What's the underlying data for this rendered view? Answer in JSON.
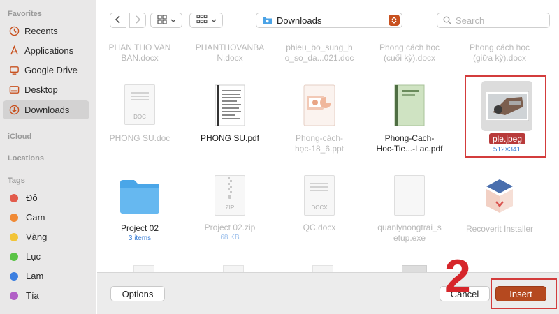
{
  "sidebar": {
    "favorites_label": "Favorites",
    "favorites": [
      {
        "label": "Recents",
        "icon": "clock-icon"
      },
      {
        "label": "Applications",
        "icon": "applications-icon"
      },
      {
        "label": "Google Drive",
        "icon": "drive-icon"
      },
      {
        "label": "Desktop",
        "icon": "desktop-icon"
      },
      {
        "label": "Downloads",
        "icon": "downloads-icon",
        "active": true
      }
    ],
    "icloud_label": "iCloud",
    "locations_label": "Locations",
    "tags_label": "Tags",
    "tags": [
      {
        "label": "Đỏ",
        "color": "#e25b4c"
      },
      {
        "label": "Cam",
        "color": "#f08a36"
      },
      {
        "label": "Vàng",
        "color": "#f2c438"
      },
      {
        "label": "Lục",
        "color": "#5ac346"
      },
      {
        "label": "Lam",
        "color": "#3c7fe0"
      },
      {
        "label": "Tía",
        "color": "#b15fc6"
      }
    ]
  },
  "toolbar": {
    "location": "Downloads",
    "search_placeholder": "Search"
  },
  "files": {
    "top_row": [
      {
        "line1": "PHAN THO VAN",
        "line2": "BAN.docx"
      },
      {
        "line1": "PHANTHOVANBA",
        "line2": "N.docx"
      },
      {
        "line1": "phieu_bo_sung_h",
        "line2": "o_so_da...021.doc"
      },
      {
        "line1": "Phong cách học",
        "line2": "(cuối kỳ).docx"
      },
      {
        "line1": "Phong cách học",
        "line2": "(giữa kỳ).docx"
      }
    ],
    "row2": [
      {
        "line1": "PHONG SU.doc",
        "line2": "",
        "badge": "DOC"
      },
      {
        "line1": "PHONG SU.pdf",
        "line2": ""
      },
      {
        "line1": "Phong-cách-",
        "line2": "học-18_6.ppt"
      },
      {
        "line1": "Phong-Cach-",
        "line2": "Hoc-Tie...-Lac.pdf"
      },
      {
        "line1": "ple.jpeg",
        "sub": "512×341"
      }
    ],
    "row3": [
      {
        "line1": "Project 02",
        "sub": "3 items"
      },
      {
        "line1": "Project 02.zip",
        "sub": "68 KB",
        "badge": "ZIP"
      },
      {
        "line1": "QC.docx",
        "badge": "DOCX"
      },
      {
        "line1": "quanlynongtrai_s",
        "line2": "etup.exe"
      },
      {
        "line1": "Recoverit Installer"
      }
    ]
  },
  "buttons": {
    "options": "Options",
    "cancel": "Cancel",
    "insert": "Insert"
  },
  "annotation": {
    "step": "2"
  }
}
